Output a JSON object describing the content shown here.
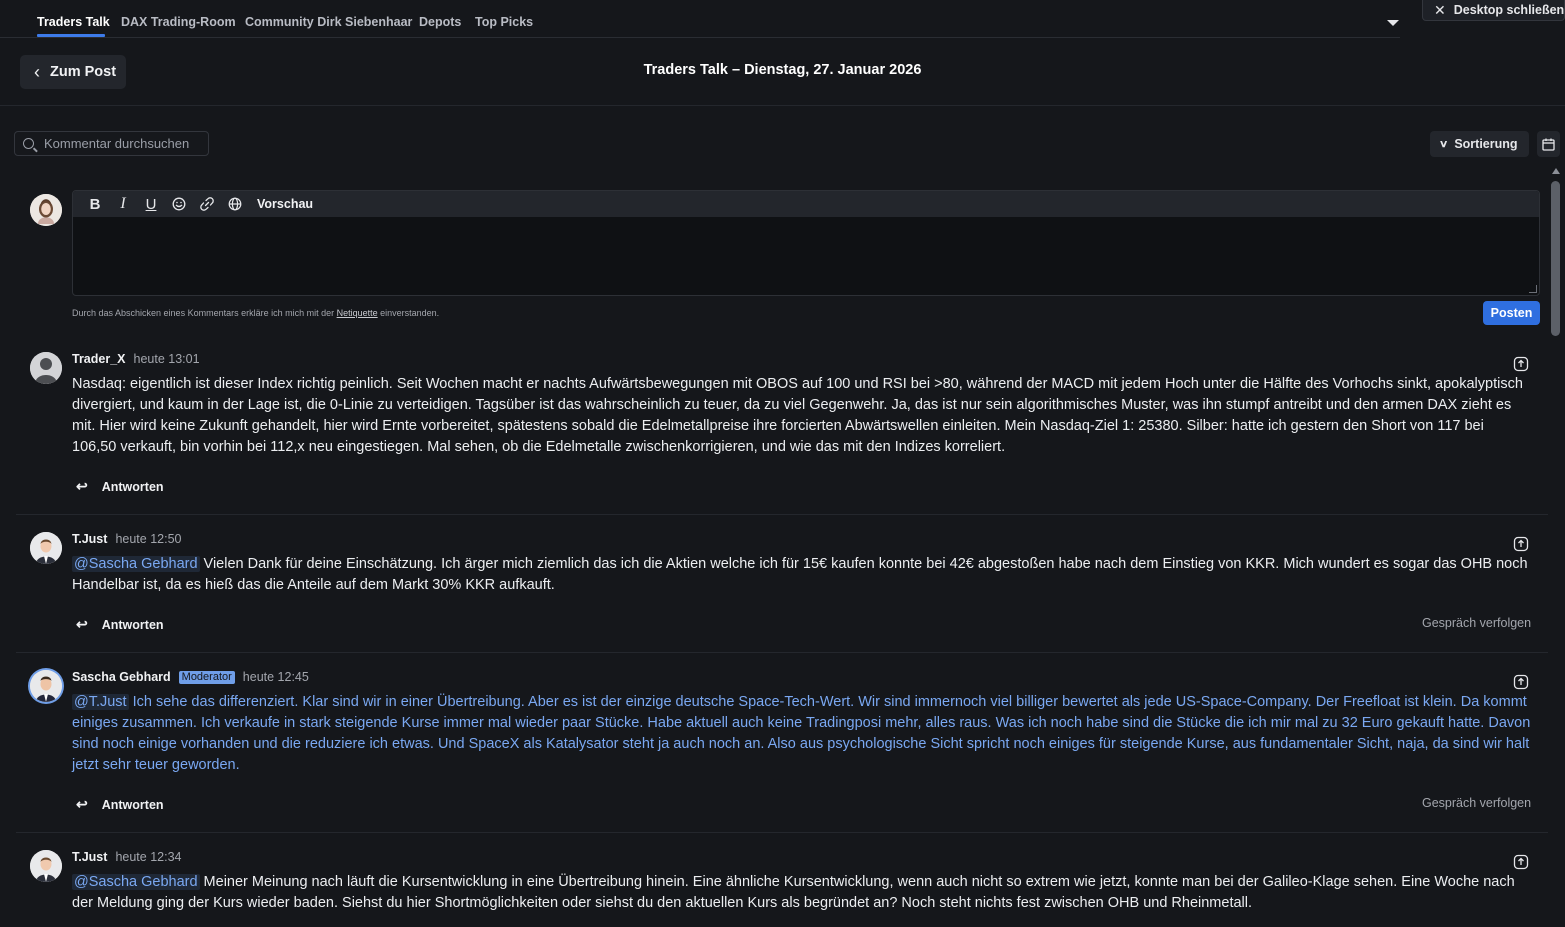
{
  "nav": {
    "tabs": [
      "Traders Talk",
      "DAX Trading-Room",
      "Community Dirk Siebenhaar",
      "Depots",
      "Top Picks"
    ],
    "close_desktop": "Desktop schließen"
  },
  "header": {
    "back_label": "Zum Post",
    "title": "Traders Talk – Dienstag, 27. Januar 2026"
  },
  "search": {
    "placeholder": "Kommentar durchsuchen"
  },
  "sort": {
    "label": "Sortierung"
  },
  "editor": {
    "preview_label": "Vorschau",
    "terms_before": "Durch das Abschicken eines Kommentars erkläre ich mich mit der ",
    "terms_link": "Netiquette",
    "terms_after": " einverstanden.",
    "post_label": "Posten"
  },
  "comments": [
    {
      "author": "Trader_X",
      "time": "heute 13:01",
      "badge": "",
      "mention": "",
      "text": "Nasdaq: eigentlich ist dieser Index richtig peinlich. Seit Wochen macht er nachts Aufwärtsbewegungen mit OBOS auf 100 und RSI bei >80, während der MACD mit jedem Hoch unter die Hälfte des Vorhochs sinkt, apokalyptisch divergiert, und kaum in der Lage ist, die 0-Linie zu verteidigen. Tagsüber ist das wahrscheinlich zu teuer, da zu viel Gegenwehr. Ja, das ist nur sein algorithmisches Muster, was ihn stumpf antreibt und den armen DAX zieht es mit. Hier wird keine Zukunft gehandelt, hier wird Ernte vorbereitet, spätestens sobald die Edelmetallpreise ihre forcierten Abwärtswellen einleiten. Mein Nasdaq-Ziel 1: 25380. Silber: hatte ich gestern den Short von 117 bei 106,50 verkauft, bin vorhin bei 112,x neu eingestiegen. Mal sehen, ob die Edelmetalle zwischenkorrigieren, und wie das mit den Indizes korreliert.",
      "reply": "Antworten",
      "follow": ""
    },
    {
      "author": "T.Just",
      "time": "heute 12:50",
      "badge": "",
      "mention": "@Sascha Gebhard",
      "text": "Vielen Dank für deine Einschätzung. Ich ärger mich ziemlich das ich die Aktien welche ich für 15€ kaufen konnte bei 42€ abgestoßen habe nach dem Einstieg von KKR. Mich wundert es sogar das OHB noch Handelbar ist, da es hieß das die Anteile auf dem Markt 30% KKR aufkauft.",
      "reply": "Antworten",
      "follow": "Gespräch verfolgen"
    },
    {
      "author": "Sascha Gebhard",
      "time": "heute 12:45",
      "badge": "Moderator",
      "mention": "@T.Just",
      "text": "Ich sehe das differenziert. Klar sind wir in einer Übertreibung. Aber es ist der einzige deutsche Space-Tech-Wert. Wir sind immernoch viel billiger bewertet als jede US-Space-Company. Der Freefloat ist klein. Da kommt einiges zusammen. Ich verkaufe in stark steigende Kurse immer mal wieder paar Stücke. Habe aktuell auch keine Tradingposi mehr, alles raus. Was ich noch habe sind die Stücke die ich mir mal zu 32 Euro gekauft hatte. Davon sind noch einige vorhanden und die reduziere ich etwas. Und SpaceX als Katalysator steht ja auch noch an. Also aus psychologische Sicht spricht noch einiges für steigende Kurse, aus fundamentaler Sicht, naja, da sind wir halt jetzt sehr teuer geworden.",
      "reply": "Antworten",
      "follow": "Gespräch verfolgen"
    },
    {
      "author": "T.Just",
      "time": "heute 12:34",
      "badge": "",
      "mention": "@Sascha Gebhard",
      "text": "Meiner Meinung nach läuft die Kursentwicklung in eine Übertreibung hinein. Eine ähnliche Kursentwicklung, wenn auch nicht so extrem wie jetzt, konnte man bei der Galileo-Klage sehen. Eine Woche nach der Meldung ging der Kurs wieder baden. Siehst du hier Shortmöglichkeiten oder siehst du den aktuellen Kurs als begründet an? Noch steht nichts fest zwischen OHB und Rheinmetall.",
      "reply": "",
      "follow": ""
    }
  ]
}
